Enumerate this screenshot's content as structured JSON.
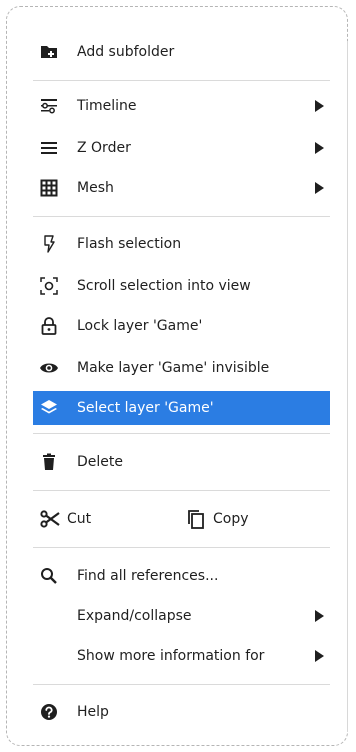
{
  "menu": {
    "add_subfolder": "Add subfolder",
    "timeline": "Timeline",
    "z_order": "Z Order",
    "mesh": "Mesh",
    "flash_selection": "Flash selection",
    "scroll_selection": "Scroll selection into view",
    "lock_layer": "Lock layer 'Game'",
    "make_invisible": "Make layer 'Game' invisible",
    "select_layer": "Select layer 'Game'",
    "delete": "Delete",
    "cut": "Cut",
    "copy": "Copy",
    "find_references": "Find all references...",
    "expand_collapse": "Expand/collapse",
    "show_more_info": "Show more information for",
    "help": "Help"
  },
  "icons": {
    "add_subfolder": "folder-plus-icon",
    "timeline": "timeline-icon",
    "z_order": "list-lines-icon",
    "mesh": "grid-icon",
    "flash_selection": "flash-icon",
    "scroll_selection": "target-icon",
    "lock_layer": "lock-icon",
    "make_invisible": "eye-icon",
    "select_layer": "layers-icon",
    "delete": "trash-icon",
    "cut": "scissors-icon",
    "copy": "copy-icon",
    "find_references": "search-icon",
    "help": "help-icon"
  },
  "colors": {
    "highlight": "#2b7de3",
    "text": "#1f1f1f",
    "separator": "#dadada"
  }
}
